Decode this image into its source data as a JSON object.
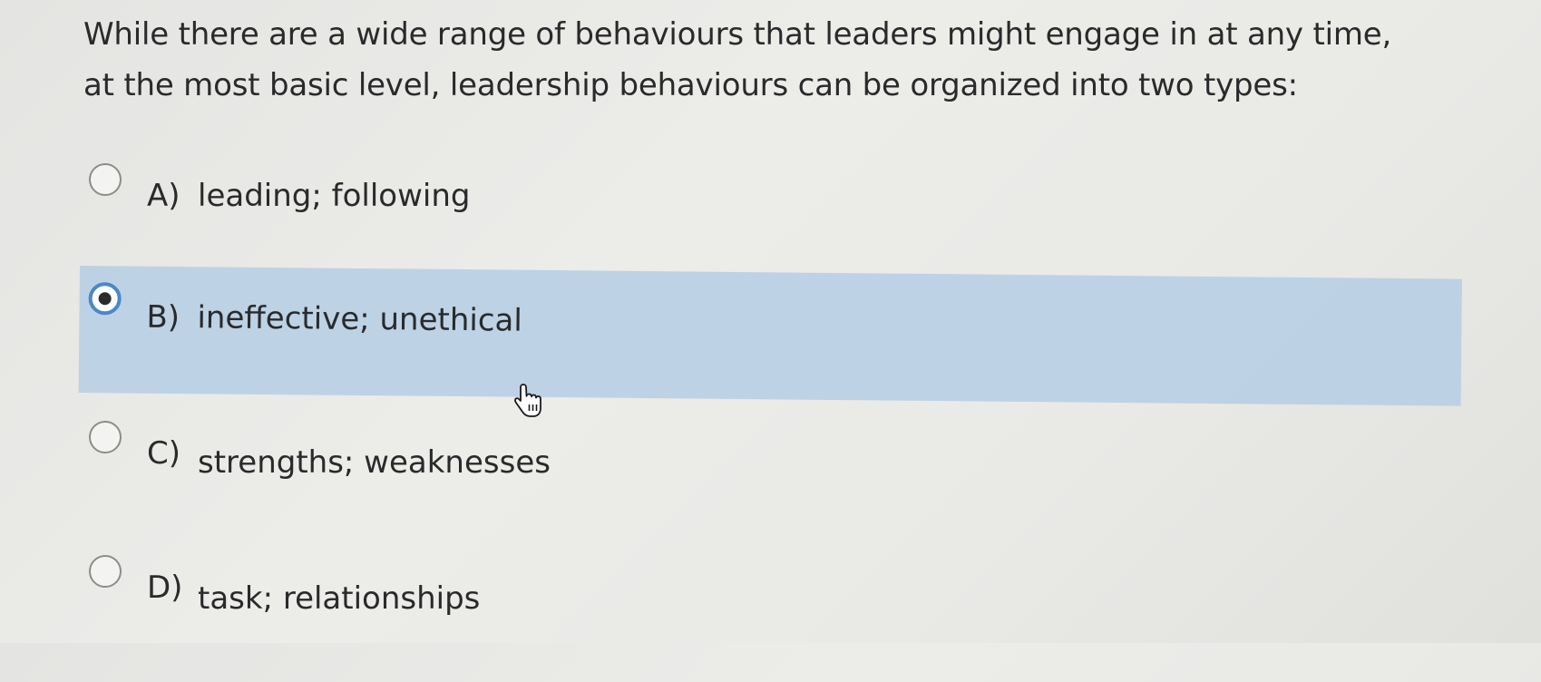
{
  "question": {
    "line1": "While there are a wide range of behaviours that leaders might engage in at any time,",
    "line2": "at the most basic level, leadership behaviours can be organized into two types:"
  },
  "options": [
    {
      "letter": "A)",
      "text": "leading; following",
      "selected": false
    },
    {
      "letter": "B)",
      "text": "ineffective; unethical",
      "selected": true
    },
    {
      "letter": "C)",
      "text": "strengths; weaknesses",
      "selected": false
    },
    {
      "letter": "D)",
      "text": "task; relationships",
      "selected": false
    }
  ],
  "colors": {
    "selected_background": "#b8cfe4",
    "radio_checked_ring": "#4a88c8"
  },
  "icons": {
    "cursor": "hand-pointer-icon"
  }
}
